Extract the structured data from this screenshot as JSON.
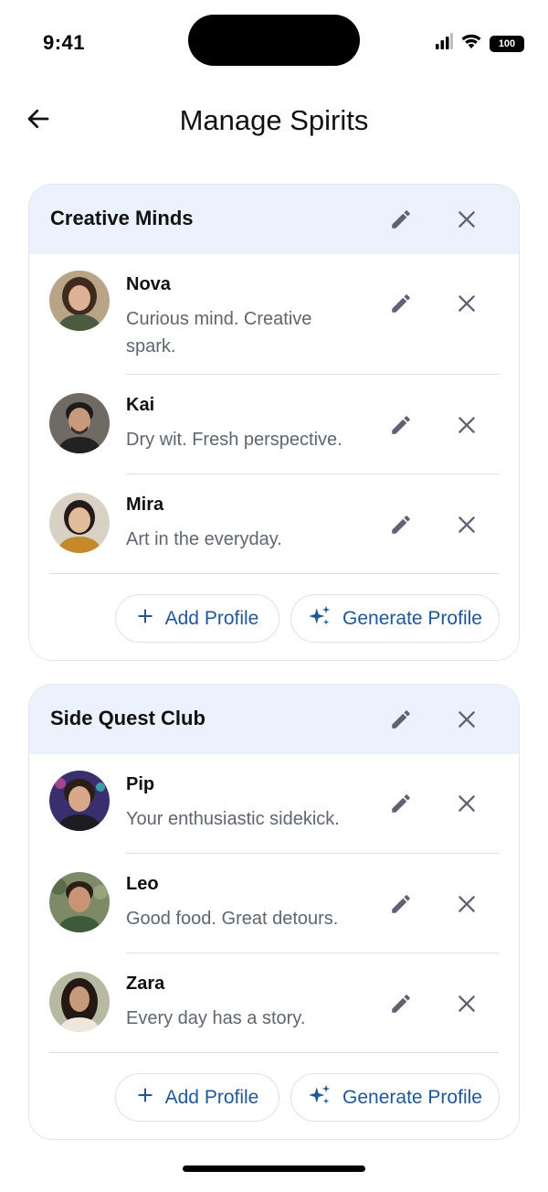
{
  "status_bar": {
    "time": "9:41",
    "battery": "100"
  },
  "header": {
    "title": "Manage Spirits",
    "back_icon": "arrow-left-icon"
  },
  "colors": {
    "accent": "#1f5799",
    "header_bg": "#ebf2fe",
    "muted_text": "#5f6670",
    "icon": "#5d6370"
  },
  "groups": [
    {
      "title": "Creative Minds",
      "profiles": [
        {
          "name": "Nova",
          "description": "Curious mind. Creative spark."
        },
        {
          "name": "Kai",
          "description": "Dry wit. Fresh perspective."
        },
        {
          "name": "Mira",
          "description": "Art in the everyday."
        }
      ],
      "add_label": "Add Profile",
      "generate_label": "Generate Profile"
    },
    {
      "title": "Side Quest Club",
      "profiles": [
        {
          "name": "Pip",
          "description": "Your enthusiastic sidekick."
        },
        {
          "name": "Leo",
          "description": "Good food. Great detours."
        },
        {
          "name": "Zara",
          "description": "Every day has a story."
        }
      ],
      "add_label": "Add Profile",
      "generate_label": "Generate Profile"
    }
  ]
}
